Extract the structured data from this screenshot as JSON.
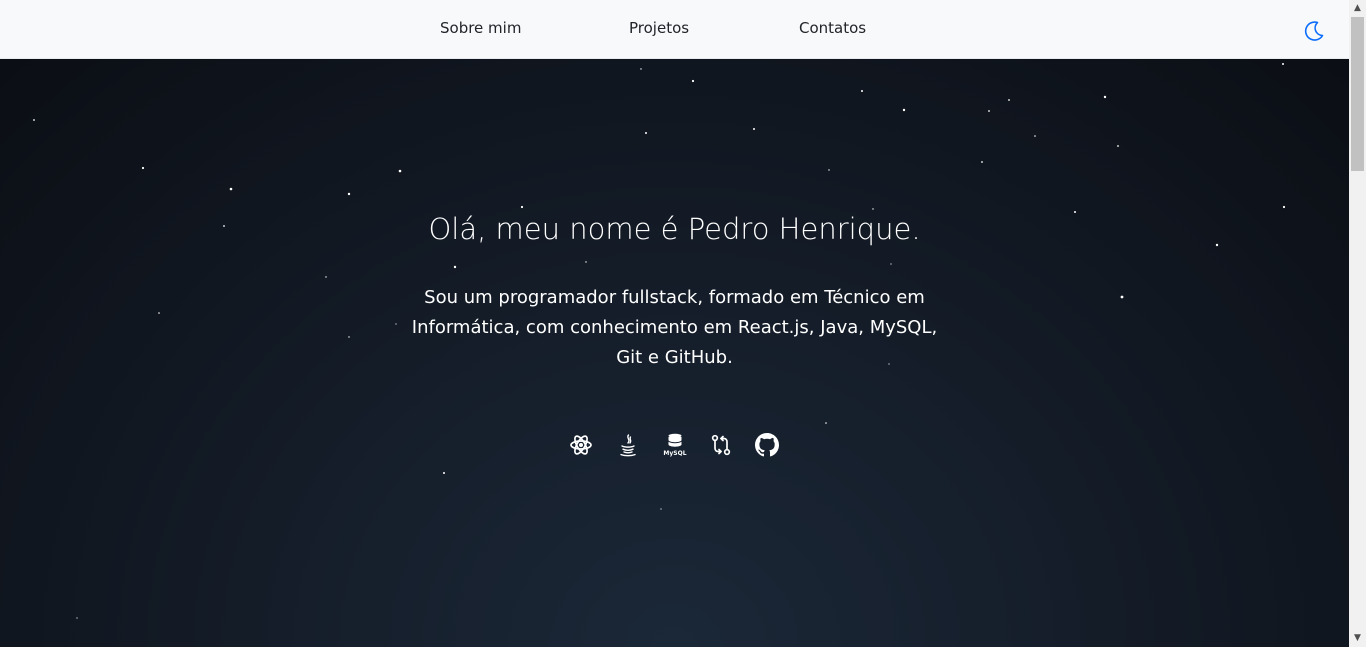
{
  "nav": {
    "items": [
      "Sobre mim",
      "Projetos",
      "Contatos"
    ],
    "theme_toggle_icon": "moon-icon"
  },
  "hero": {
    "title": "Olá, meu nome é Pedro Henrique.",
    "description": "Sou um programador fullstack, formado em Técnico em Informática, com conhecimento em React.js, Java, MySQL, Git e GitHub.",
    "tech_icons": [
      "react-icon",
      "java-icon",
      "mysql-icon",
      "git-icon",
      "github-icon"
    ],
    "mysql_icon_text": "MySQL"
  },
  "colors": {
    "navbar_bg": "#f8f9fa",
    "nav_text": "#212529",
    "accent": "#0d6efd",
    "hero_bg_dark": "#0b0e14",
    "hero_bg_light": "#1b2838",
    "hero_text": "#ffffff"
  }
}
